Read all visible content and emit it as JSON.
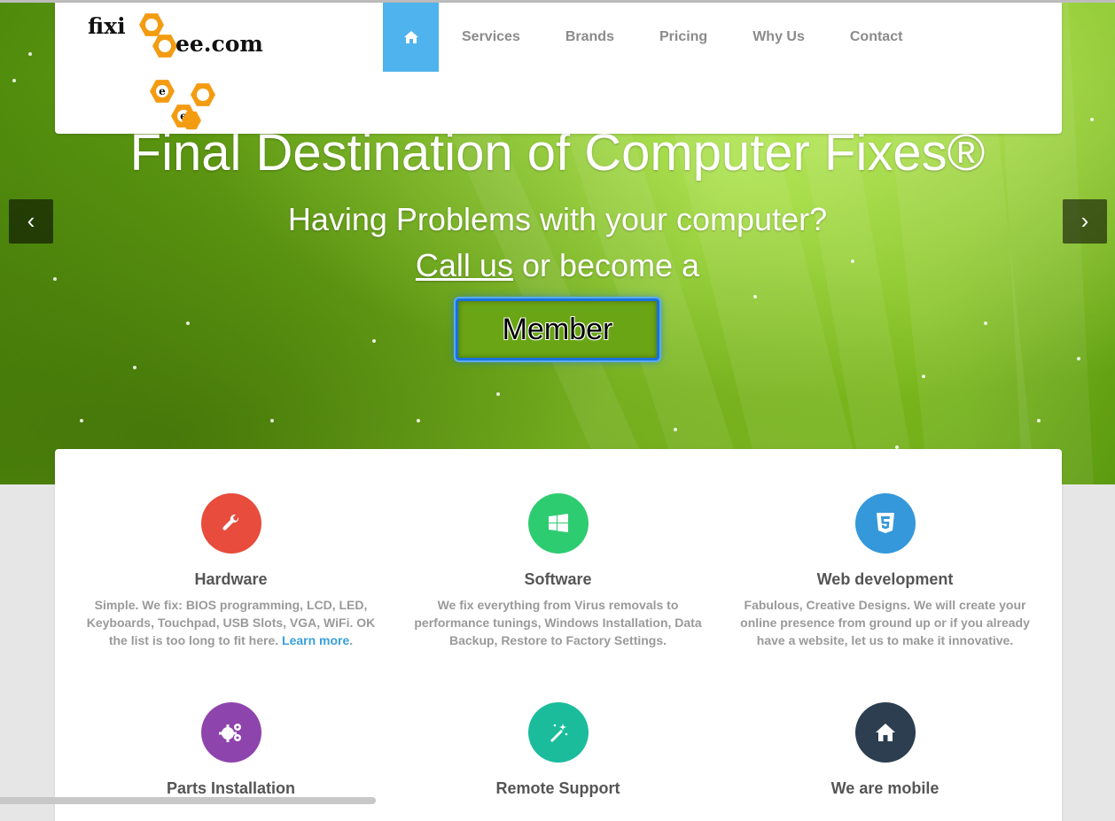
{
  "header": {
    "logo": {
      "text_left": "fixi",
      "text_right": "ee.com",
      "hex_letters": [
        "e",
        "e"
      ]
    },
    "nav": {
      "home_icon": "home-icon",
      "items": [
        "Services",
        "Brands",
        "Pricing",
        "Why Us",
        "Contact"
      ]
    }
  },
  "hero": {
    "title": "Final Destination of Computer Fixes®",
    "subtitle": "Having Problems with your computer?",
    "call_link": "Call us",
    "call_rest": " or become a",
    "member_button": "Member",
    "prev_arrow": "‹",
    "next_arrow": "›"
  },
  "features": [
    {
      "title": "Hardware",
      "icon": "wrench-icon",
      "color": "#e74c3c",
      "text": "Simple. We fix: BIOS programming, LCD, LED, Keyboards, Touchpad, USB Slots, VGA, WiFi. OK the list is too long to fit here. ",
      "link": "Learn more",
      "link_suffix": "."
    },
    {
      "title": "Software",
      "icon": "windows-icon",
      "color": "#2ecc71",
      "text": "We fix everything from Virus removals to performance tunings, Windows Installation, Data Backup, Restore to Factory Settings."
    },
    {
      "title": "Web development",
      "icon": "html5-icon",
      "color": "#3498db",
      "text": "Fabulous, Creative Designs. We will create your online presence from ground up or if you already have a website, let us to make it innovative."
    },
    {
      "title": "Parts Installation",
      "icon": "gears-icon",
      "color": "#8e44ad"
    },
    {
      "title": "Remote Support",
      "icon": "magic-wand-icon",
      "color": "#1abc9c"
    },
    {
      "title": "We are mobile",
      "icon": "home-icon",
      "color": "#2c3e50"
    }
  ]
}
